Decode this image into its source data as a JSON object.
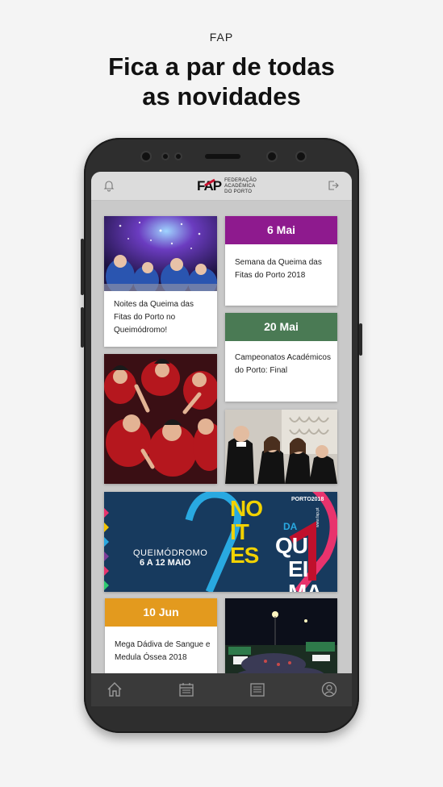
{
  "page": {
    "kicker": "FAP",
    "headline_line1": "Fica a par de todas",
    "headline_line2": "as novidades"
  },
  "app": {
    "logo_mark": "FAP",
    "logo_words": [
      "FEDERAÇÃO",
      "ACADÉMICA",
      "DO PORTO"
    ]
  },
  "cards": {
    "noites": {
      "title": "Noites da Queima das Fitas do Porto no Queimódromo!"
    },
    "semana": {
      "date": "6 Mai",
      "title": "Semana da Queima das Fitas do Porto 2018",
      "color": "#8e1a8e"
    },
    "campeonatos": {
      "date": "20 Mai",
      "title": "Campeonatos Académicos do Porto: Final",
      "color": "#4a7a54"
    },
    "dadiva": {
      "date": "10 Jun",
      "title": "Mega Dádiva de Sangue e Medula Óssea 2018",
      "color": "#e39a1e"
    }
  },
  "banner": {
    "location": "QUEIMÓDROMO",
    "dates": "6 A 12 MAIO",
    "noites_letters": [
      "NO",
      "IT",
      "ES"
    ],
    "da": "DA",
    "queima": [
      "QU",
      "EI",
      "MA"
    ],
    "porto_tag": "PORTO2018",
    "number": "2",
    "side_text": "www.fap.pt"
  },
  "nav": {
    "items": [
      "home",
      "calendar",
      "news",
      "profile"
    ]
  }
}
